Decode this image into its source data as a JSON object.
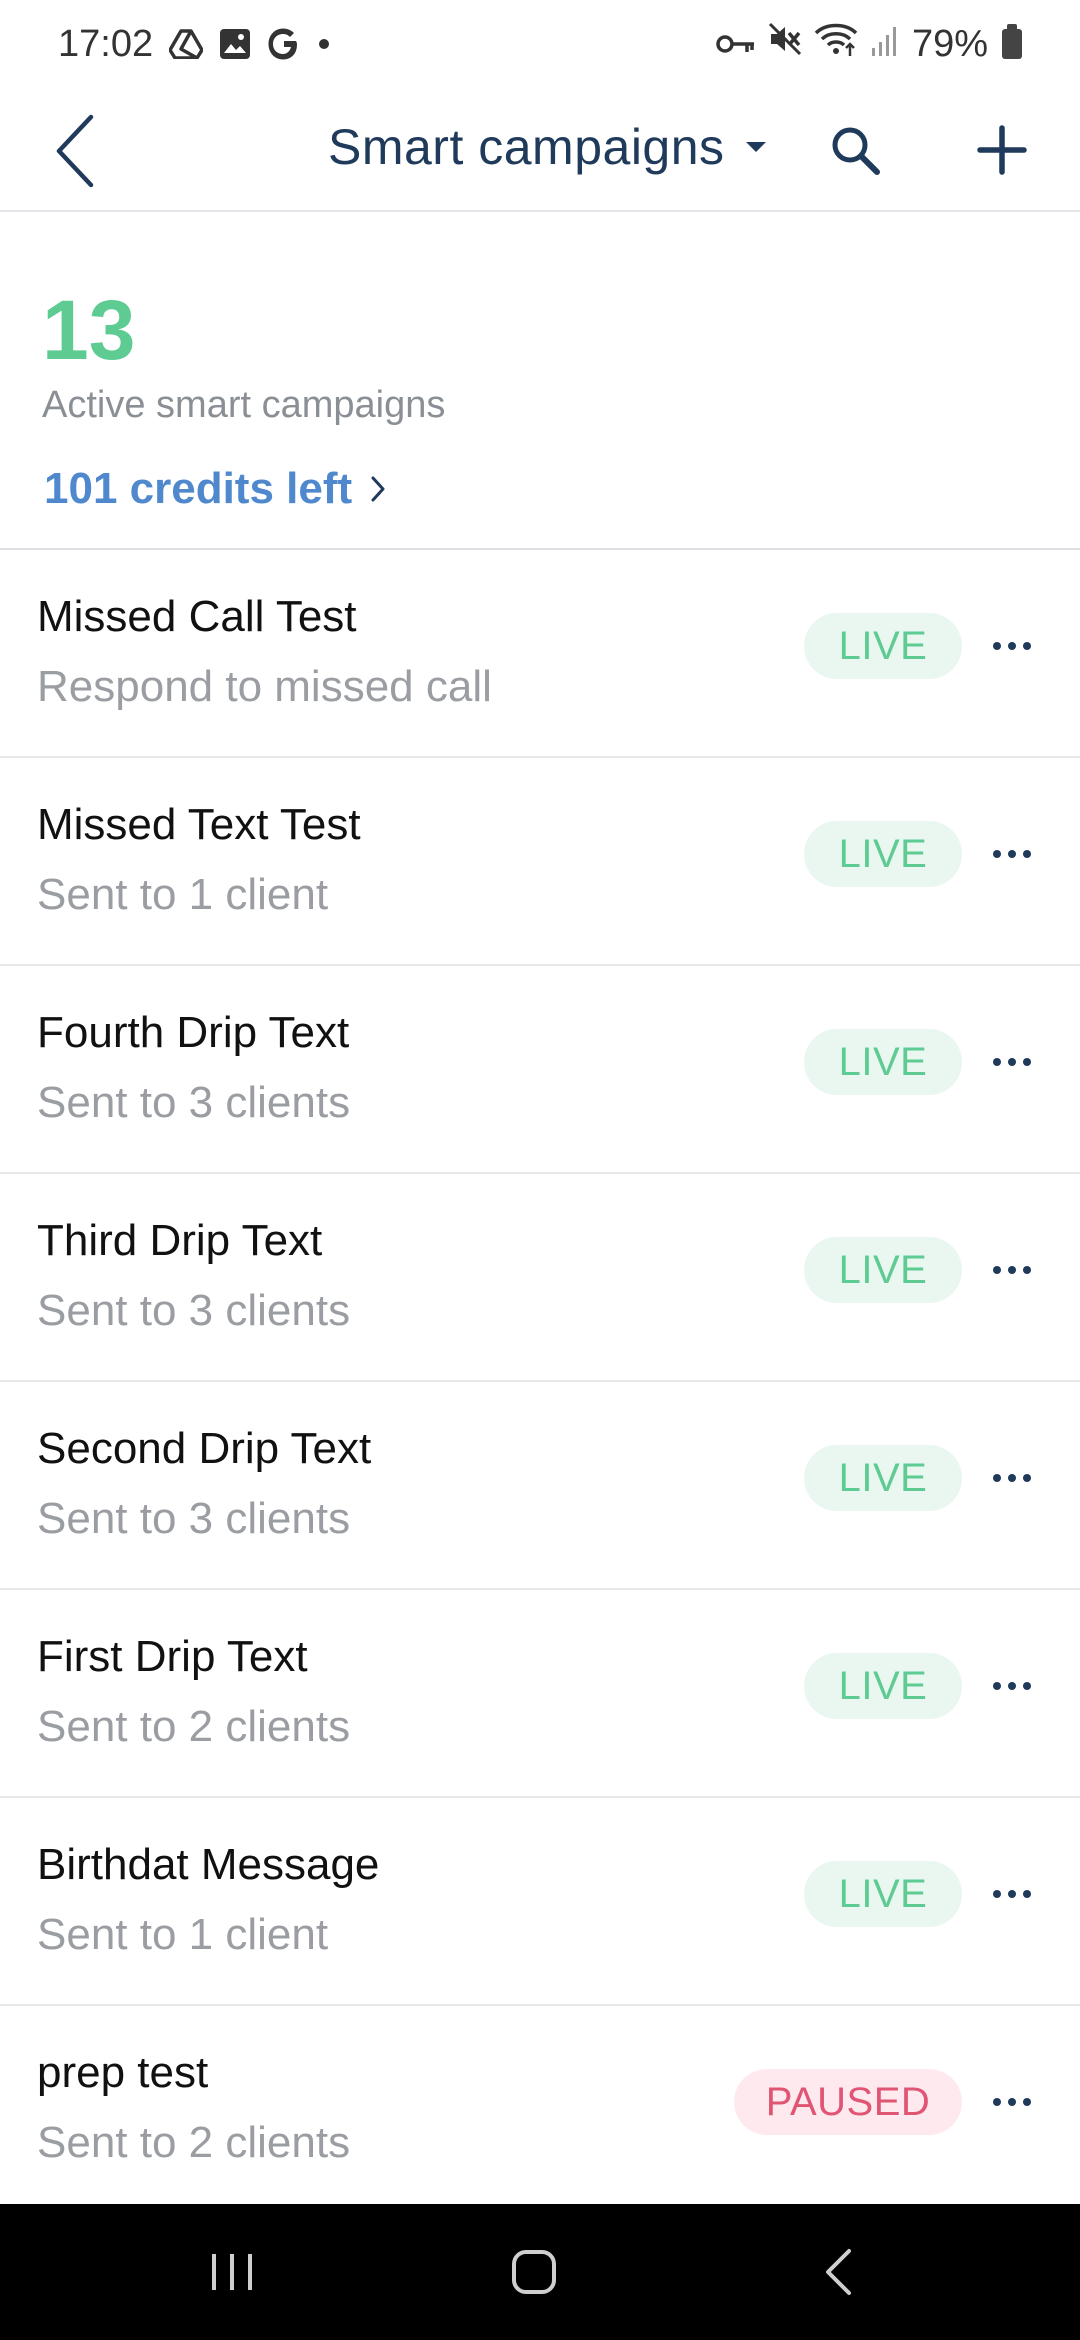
{
  "status_bar": {
    "time": "17:02",
    "battery": "79%",
    "left_icons": [
      "drive-icon",
      "image-icon",
      "google-icon",
      "dot-icon"
    ],
    "right_icons": [
      "vpn-key-icon",
      "mute-icon",
      "wifi-icon",
      "signal-icon",
      "battery-icon"
    ]
  },
  "app_bar": {
    "title": "Smart campaigns",
    "back_icon": "chevron-left-icon",
    "dropdown_icon": "caret-down-icon",
    "search_icon": "search-icon",
    "add_icon": "plus-icon"
  },
  "summary": {
    "active_count": "13",
    "active_label": "Active smart campaigns",
    "credits": "101 credits left"
  },
  "campaigns": [
    {
      "title": "Missed Call Test",
      "subtitle": "Respond to missed call",
      "status": "LIVE"
    },
    {
      "title": "Missed Text Test",
      "subtitle": "Sent to 1 client",
      "status": "LIVE"
    },
    {
      "title": "Fourth Drip Text",
      "subtitle": "Sent to 3 clients",
      "status": "LIVE"
    },
    {
      "title": "Third Drip Text",
      "subtitle": "Sent to 3 clients",
      "status": "LIVE"
    },
    {
      "title": "Second Drip Text",
      "subtitle": "Sent to 3 clients",
      "status": "LIVE"
    },
    {
      "title": "First Drip Text",
      "subtitle": "Sent to 2 clients",
      "status": "LIVE"
    },
    {
      "title": "Birthdat Message",
      "subtitle": "Sent to 1 client",
      "status": "LIVE"
    },
    {
      "title": "prep test",
      "subtitle": "Sent to 2 clients",
      "status": "PAUSED"
    }
  ],
  "colors": {
    "accent_green": "#5ecb93",
    "live_bg": "#e9f7f0",
    "paused_text": "#e05573",
    "paused_bg": "#fde9ee",
    "link_blue": "#4f88cc",
    "title_navy": "#1f3a5a"
  },
  "nav_bar": {
    "icons": [
      "recent-apps-icon",
      "home-icon",
      "back-icon"
    ]
  }
}
